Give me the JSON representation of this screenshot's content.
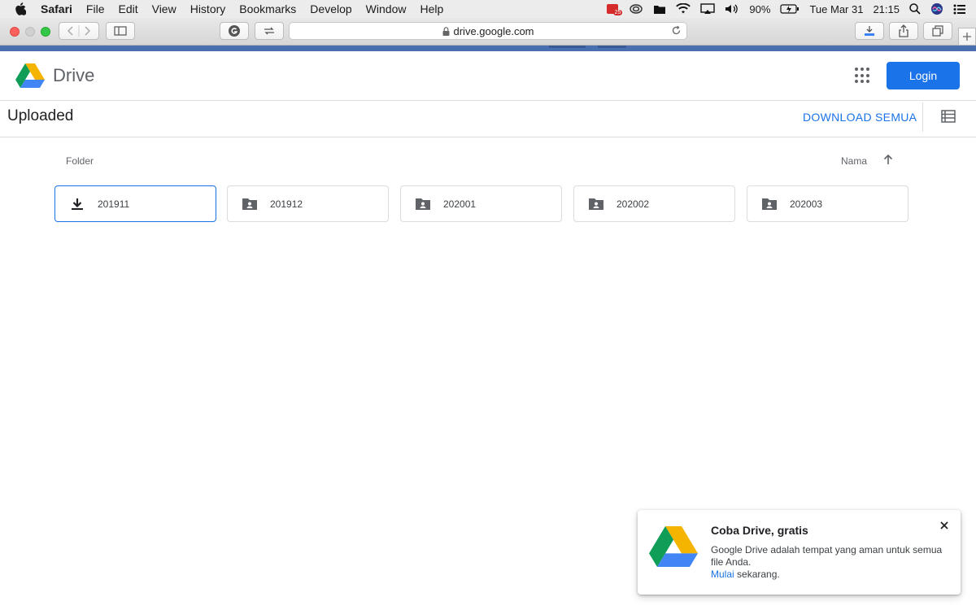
{
  "menubar": {
    "items": [
      "Safari",
      "File",
      "Edit",
      "View",
      "History",
      "Bookmarks",
      "Develop",
      "Window",
      "Help"
    ],
    "status": {
      "badge": "25",
      "battery": "90%",
      "date": "Tue Mar 31",
      "time": "21:15"
    }
  },
  "browser": {
    "url": "drive.google.com"
  },
  "header": {
    "logo_text": "Drive",
    "login_label": "Login"
  },
  "subheader": {
    "title": "Uploaded",
    "download_all": "DOWNLOAD SEMUA"
  },
  "content": {
    "section_label": "Folder",
    "sort_label": "Nama",
    "folders": [
      {
        "name": "201911",
        "icon": "download-icon"
      },
      {
        "name": "201912",
        "icon": "shared-folder-icon"
      },
      {
        "name": "202001",
        "icon": "shared-folder-icon"
      },
      {
        "name": "202002",
        "icon": "shared-folder-icon"
      },
      {
        "name": "202003",
        "icon": "shared-folder-icon"
      }
    ]
  },
  "promo": {
    "title": "Coba Drive, gratis",
    "body": "Google Drive adalah tempat yang aman untuk semua file Anda.",
    "link": "Mulai",
    "suffix": " sekarang."
  },
  "colors": {
    "accent": "#1a73e8",
    "drive_green": "#0f9d58",
    "drive_yellow": "#f4b400",
    "drive_blue": "#4285f4"
  }
}
